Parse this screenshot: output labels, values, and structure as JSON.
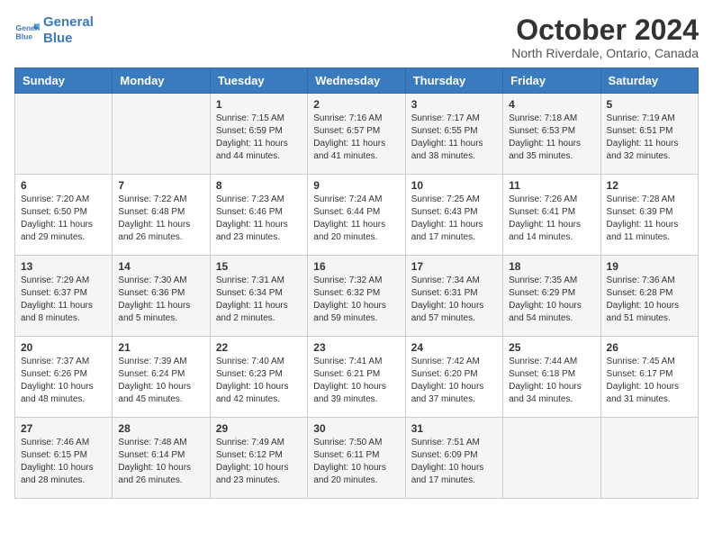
{
  "header": {
    "logo_line1": "General",
    "logo_line2": "Blue",
    "month": "October 2024",
    "location": "North Riverdale, Ontario, Canada"
  },
  "days_of_week": [
    "Sunday",
    "Monday",
    "Tuesday",
    "Wednesday",
    "Thursday",
    "Friday",
    "Saturday"
  ],
  "weeks": [
    [
      {
        "num": "",
        "text": ""
      },
      {
        "num": "",
        "text": ""
      },
      {
        "num": "1",
        "text": "Sunrise: 7:15 AM\nSunset: 6:59 PM\nDaylight: 11 hours and 44 minutes."
      },
      {
        "num": "2",
        "text": "Sunrise: 7:16 AM\nSunset: 6:57 PM\nDaylight: 11 hours and 41 minutes."
      },
      {
        "num": "3",
        "text": "Sunrise: 7:17 AM\nSunset: 6:55 PM\nDaylight: 11 hours and 38 minutes."
      },
      {
        "num": "4",
        "text": "Sunrise: 7:18 AM\nSunset: 6:53 PM\nDaylight: 11 hours and 35 minutes."
      },
      {
        "num": "5",
        "text": "Sunrise: 7:19 AM\nSunset: 6:51 PM\nDaylight: 11 hours and 32 minutes."
      }
    ],
    [
      {
        "num": "6",
        "text": "Sunrise: 7:20 AM\nSunset: 6:50 PM\nDaylight: 11 hours and 29 minutes."
      },
      {
        "num": "7",
        "text": "Sunrise: 7:22 AM\nSunset: 6:48 PM\nDaylight: 11 hours and 26 minutes."
      },
      {
        "num": "8",
        "text": "Sunrise: 7:23 AM\nSunset: 6:46 PM\nDaylight: 11 hours and 23 minutes."
      },
      {
        "num": "9",
        "text": "Sunrise: 7:24 AM\nSunset: 6:44 PM\nDaylight: 11 hours and 20 minutes."
      },
      {
        "num": "10",
        "text": "Sunrise: 7:25 AM\nSunset: 6:43 PM\nDaylight: 11 hours and 17 minutes."
      },
      {
        "num": "11",
        "text": "Sunrise: 7:26 AM\nSunset: 6:41 PM\nDaylight: 11 hours and 14 minutes."
      },
      {
        "num": "12",
        "text": "Sunrise: 7:28 AM\nSunset: 6:39 PM\nDaylight: 11 hours and 11 minutes."
      }
    ],
    [
      {
        "num": "13",
        "text": "Sunrise: 7:29 AM\nSunset: 6:37 PM\nDaylight: 11 hours and 8 minutes."
      },
      {
        "num": "14",
        "text": "Sunrise: 7:30 AM\nSunset: 6:36 PM\nDaylight: 11 hours and 5 minutes."
      },
      {
        "num": "15",
        "text": "Sunrise: 7:31 AM\nSunset: 6:34 PM\nDaylight: 11 hours and 2 minutes."
      },
      {
        "num": "16",
        "text": "Sunrise: 7:32 AM\nSunset: 6:32 PM\nDaylight: 10 hours and 59 minutes."
      },
      {
        "num": "17",
        "text": "Sunrise: 7:34 AM\nSunset: 6:31 PM\nDaylight: 10 hours and 57 minutes."
      },
      {
        "num": "18",
        "text": "Sunrise: 7:35 AM\nSunset: 6:29 PM\nDaylight: 10 hours and 54 minutes."
      },
      {
        "num": "19",
        "text": "Sunrise: 7:36 AM\nSunset: 6:28 PM\nDaylight: 10 hours and 51 minutes."
      }
    ],
    [
      {
        "num": "20",
        "text": "Sunrise: 7:37 AM\nSunset: 6:26 PM\nDaylight: 10 hours and 48 minutes."
      },
      {
        "num": "21",
        "text": "Sunrise: 7:39 AM\nSunset: 6:24 PM\nDaylight: 10 hours and 45 minutes."
      },
      {
        "num": "22",
        "text": "Sunrise: 7:40 AM\nSunset: 6:23 PM\nDaylight: 10 hours and 42 minutes."
      },
      {
        "num": "23",
        "text": "Sunrise: 7:41 AM\nSunset: 6:21 PM\nDaylight: 10 hours and 39 minutes."
      },
      {
        "num": "24",
        "text": "Sunrise: 7:42 AM\nSunset: 6:20 PM\nDaylight: 10 hours and 37 minutes."
      },
      {
        "num": "25",
        "text": "Sunrise: 7:44 AM\nSunset: 6:18 PM\nDaylight: 10 hours and 34 minutes."
      },
      {
        "num": "26",
        "text": "Sunrise: 7:45 AM\nSunset: 6:17 PM\nDaylight: 10 hours and 31 minutes."
      }
    ],
    [
      {
        "num": "27",
        "text": "Sunrise: 7:46 AM\nSunset: 6:15 PM\nDaylight: 10 hours and 28 minutes."
      },
      {
        "num": "28",
        "text": "Sunrise: 7:48 AM\nSunset: 6:14 PM\nDaylight: 10 hours and 26 minutes."
      },
      {
        "num": "29",
        "text": "Sunrise: 7:49 AM\nSunset: 6:12 PM\nDaylight: 10 hours and 23 minutes."
      },
      {
        "num": "30",
        "text": "Sunrise: 7:50 AM\nSunset: 6:11 PM\nDaylight: 10 hours and 20 minutes."
      },
      {
        "num": "31",
        "text": "Sunrise: 7:51 AM\nSunset: 6:09 PM\nDaylight: 10 hours and 17 minutes."
      },
      {
        "num": "",
        "text": ""
      },
      {
        "num": "",
        "text": ""
      }
    ]
  ]
}
